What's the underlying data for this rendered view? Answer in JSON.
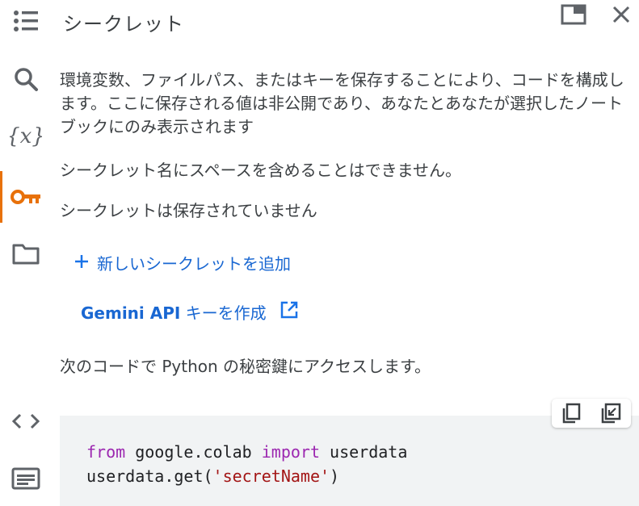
{
  "panel": {
    "title": "シークレット",
    "description": "環境変数、ファイルパス、またはキーを保存することにより、コードを構成します。ここに保存される値は非公開であり、あなたとあなたが選択したノートブックにのみ表示されます",
    "name_note": "シークレット名にスペースを含めることはできません。",
    "empty_note": "シークレットは保存されていません",
    "add_secret_label": "新しいシークレットを追加",
    "gemini_label_bold": "Gemini API",
    "gemini_label_rest": " キーを作成",
    "access_note": "次のコードで Python の秘密鍵にアクセスします。"
  },
  "code": {
    "kw_from": "from",
    "module": " google.colab ",
    "kw_import": "import",
    "name": " userdata",
    "call_prefix": "userdata.get(",
    "string_literal": "'secretName'",
    "call_suffix": ")"
  },
  "rail": {
    "items": [
      "toc-icon",
      "search-icon",
      "variables-icon",
      "key-icon",
      "folder-icon",
      "code-snippets-icon",
      "terminal-icon"
    ],
    "active": "key-icon",
    "active_color": "#e8710a"
  },
  "colors": {
    "link": "#1a73e8",
    "keyword": "#9c27b0",
    "string": "#a31515",
    "code_bg": "#f1f3f4"
  }
}
